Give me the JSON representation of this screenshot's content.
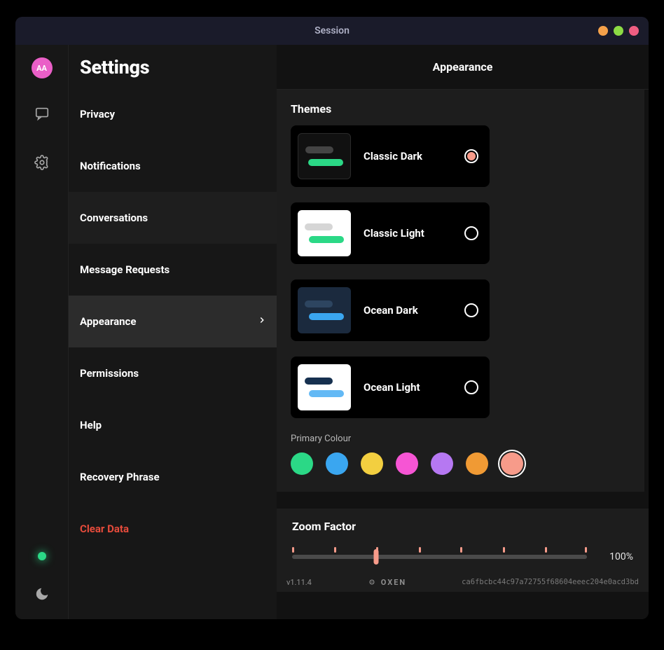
{
  "window": {
    "title": "Session"
  },
  "avatar": {
    "initials": "AA"
  },
  "sidebar": {
    "title": "Settings",
    "items": [
      {
        "label": "Privacy"
      },
      {
        "label": "Notifications"
      },
      {
        "label": "Conversations"
      },
      {
        "label": "Message Requests"
      },
      {
        "label": "Appearance"
      },
      {
        "label": "Permissions"
      },
      {
        "label": "Help"
      },
      {
        "label": "Recovery Phrase"
      },
      {
        "label": "Clear Data"
      }
    ]
  },
  "main": {
    "title": "Appearance",
    "themes_label": "Themes",
    "themes": [
      {
        "name": "Classic Dark",
        "selected": true
      },
      {
        "name": "Classic Light",
        "selected": false
      },
      {
        "name": "Ocean Dark",
        "selected": false
      },
      {
        "name": "Ocean Light",
        "selected": false
      }
    ],
    "primary_colour_label": "Primary Colour",
    "primary_colours": [
      {
        "hex": "#2bd886",
        "selected": false
      },
      {
        "hex": "#3aa6f0",
        "selected": false
      },
      {
        "hex": "#f3cf40",
        "selected": false
      },
      {
        "hex": "#f655d4",
        "selected": false
      },
      {
        "hex": "#b678f2",
        "selected": false
      },
      {
        "hex": "#f09a34",
        "selected": false
      },
      {
        "hex": "#f79b8a",
        "selected": true
      }
    ],
    "zoom": {
      "label": "Zoom Factor",
      "value_text": "100%",
      "thumb_percent": 28.6
    }
  },
  "footer": {
    "version": "v1.11.4",
    "brand": "OXEN",
    "hash": "ca6fbcbc44c97a72755f68604eeec204e0acd3bd"
  }
}
